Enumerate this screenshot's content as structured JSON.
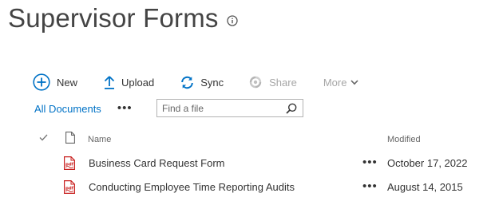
{
  "page": {
    "title": "Supervisor Forms",
    "info_icon": "info-icon"
  },
  "commands": {
    "new_label": "New",
    "upload_label": "Upload",
    "sync_label": "Sync",
    "share_label": "Share",
    "more_label": "More"
  },
  "view": {
    "current_view": "All Documents",
    "ellipsis": "•••"
  },
  "search": {
    "placeholder": "Find a file",
    "value": ""
  },
  "columns": {
    "name": "Name",
    "modified": "Modified"
  },
  "files": [
    {
      "name": "Business Card Request Form",
      "modified": "October 17, 2022",
      "type": "pdf",
      "more": "•••"
    },
    {
      "name": "Conducting Employee Time Reporting Audits",
      "modified": "August 14, 2015",
      "type": "pdf",
      "more": "•••"
    }
  ],
  "colors": {
    "accent": "#0072c6",
    "disabled": "#a6a6a6",
    "pdf_red": "#c8201f"
  }
}
